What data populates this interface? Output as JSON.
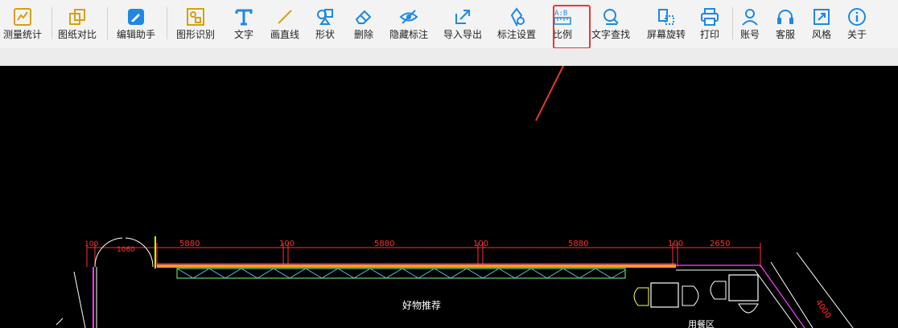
{
  "toolbar": {
    "items": [
      {
        "label": "测量统计",
        "icon": "measure-stats-icon"
      },
      {
        "label": "图纸对比",
        "icon": "compare-icon"
      },
      {
        "label": "编辑助手",
        "icon": "edit-assistant-icon"
      },
      {
        "label": "图形识别",
        "icon": "shape-recognition-icon"
      },
      {
        "label": "文字",
        "icon": "text-icon"
      },
      {
        "label": "画直线",
        "icon": "line-icon"
      },
      {
        "label": "形状",
        "icon": "shape-icon"
      },
      {
        "label": "删除",
        "icon": "eraser-icon"
      },
      {
        "label": "隐藏标注",
        "icon": "hide-eye-icon"
      },
      {
        "label": "导入导出",
        "icon": "import-export-icon"
      },
      {
        "label": "标注设置",
        "icon": "annotation-settings-icon"
      },
      {
        "label": "比例",
        "icon": "scale-ruler-icon"
      },
      {
        "label": "文字查找",
        "icon": "text-search-icon"
      },
      {
        "label": "屏幕旋转",
        "icon": "screen-rotate-icon"
      },
      {
        "label": "打印",
        "icon": "printer-icon"
      },
      {
        "label": "账号",
        "icon": "user-icon"
      },
      {
        "label": "客服",
        "icon": "headset-icon"
      },
      {
        "label": "风格",
        "icon": "style-icon"
      },
      {
        "label": "关于",
        "icon": "info-icon"
      }
    ]
  },
  "drawing": {
    "dimensions": [
      "100",
      "1060",
      "5880",
      "100",
      "5880",
      "100",
      "5880",
      "100",
      "2650",
      "4000"
    ],
    "room_label": "好物推荐",
    "area_label": "用餐区"
  },
  "colors": {
    "accent": "#1e88e5",
    "highlight": "#e53935",
    "dimension": "#ff3030"
  }
}
